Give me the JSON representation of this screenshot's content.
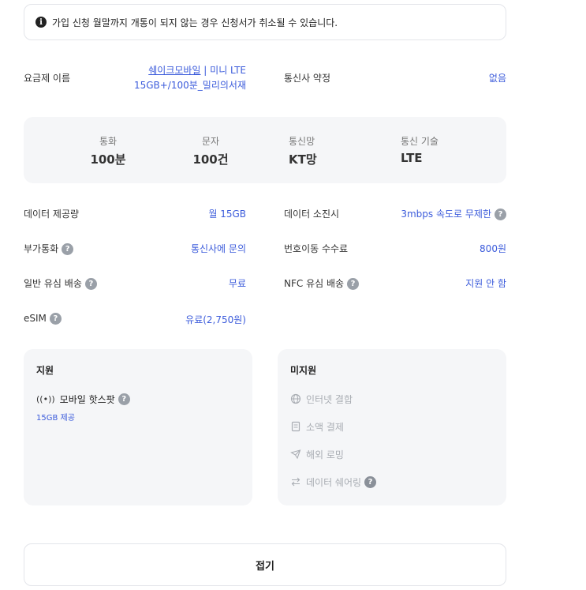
{
  "notice": {
    "icon": "info-icon",
    "text": "가입 신청 월말까지 개통이 되지 않는 경우 신청서가 취소될 수 있습니다."
  },
  "plan": {
    "label": "요금제 이름",
    "name_line1_link": "쉐이크모바일",
    "name_line1_rest": " | 미니 LTE",
    "name_line2": "15GB+/100분_밀리의서재",
    "contract_label": "통신사 약정",
    "contract_value": "없음"
  },
  "specs": [
    {
      "label": "통화",
      "value": "100분"
    },
    {
      "label": "문자",
      "value": "100건"
    },
    {
      "label": "통신망",
      "value": "KT망"
    },
    {
      "label": "통신 기술",
      "value": "LTE"
    }
  ],
  "details": {
    "data_label": "데이터 제공량",
    "data_value": "월 15GB",
    "exhaust_label": "데이터 소진시",
    "exhaust_value": "3mbps 속도로 무제한",
    "extra_call_label": "부가통화",
    "extra_call_value": "통신사에 문의",
    "port_fee_label": "번호이동 수수료",
    "port_fee_value": "800원",
    "usim_label": "일반 유심 배송",
    "usim_value": "무료",
    "nfc_label": "NFC 유심 배송",
    "nfc_value": "지원 안 함",
    "esim_label": "eSIM",
    "esim_value": "유료(2,750원)"
  },
  "supported": {
    "title": "지원",
    "items": [
      {
        "icon": "hotspot-icon",
        "label": "모바일 핫스팟",
        "sub": "15GB 제공"
      }
    ]
  },
  "unsupported": {
    "title": "미지원",
    "items": [
      {
        "icon": "internet-combo-icon",
        "label": "인터넷 결합"
      },
      {
        "icon": "micropayment-icon",
        "label": "소액 결제"
      },
      {
        "icon": "roaming-icon",
        "label": "해외 로밍"
      },
      {
        "icon": "data-sharing-icon",
        "label": "데이터 쉐어링"
      }
    ]
  },
  "fold_button": "접기",
  "colors": {
    "accent": "#3b5bdb",
    "panel": "#f5f6f8",
    "muted": "#a9adb3"
  }
}
